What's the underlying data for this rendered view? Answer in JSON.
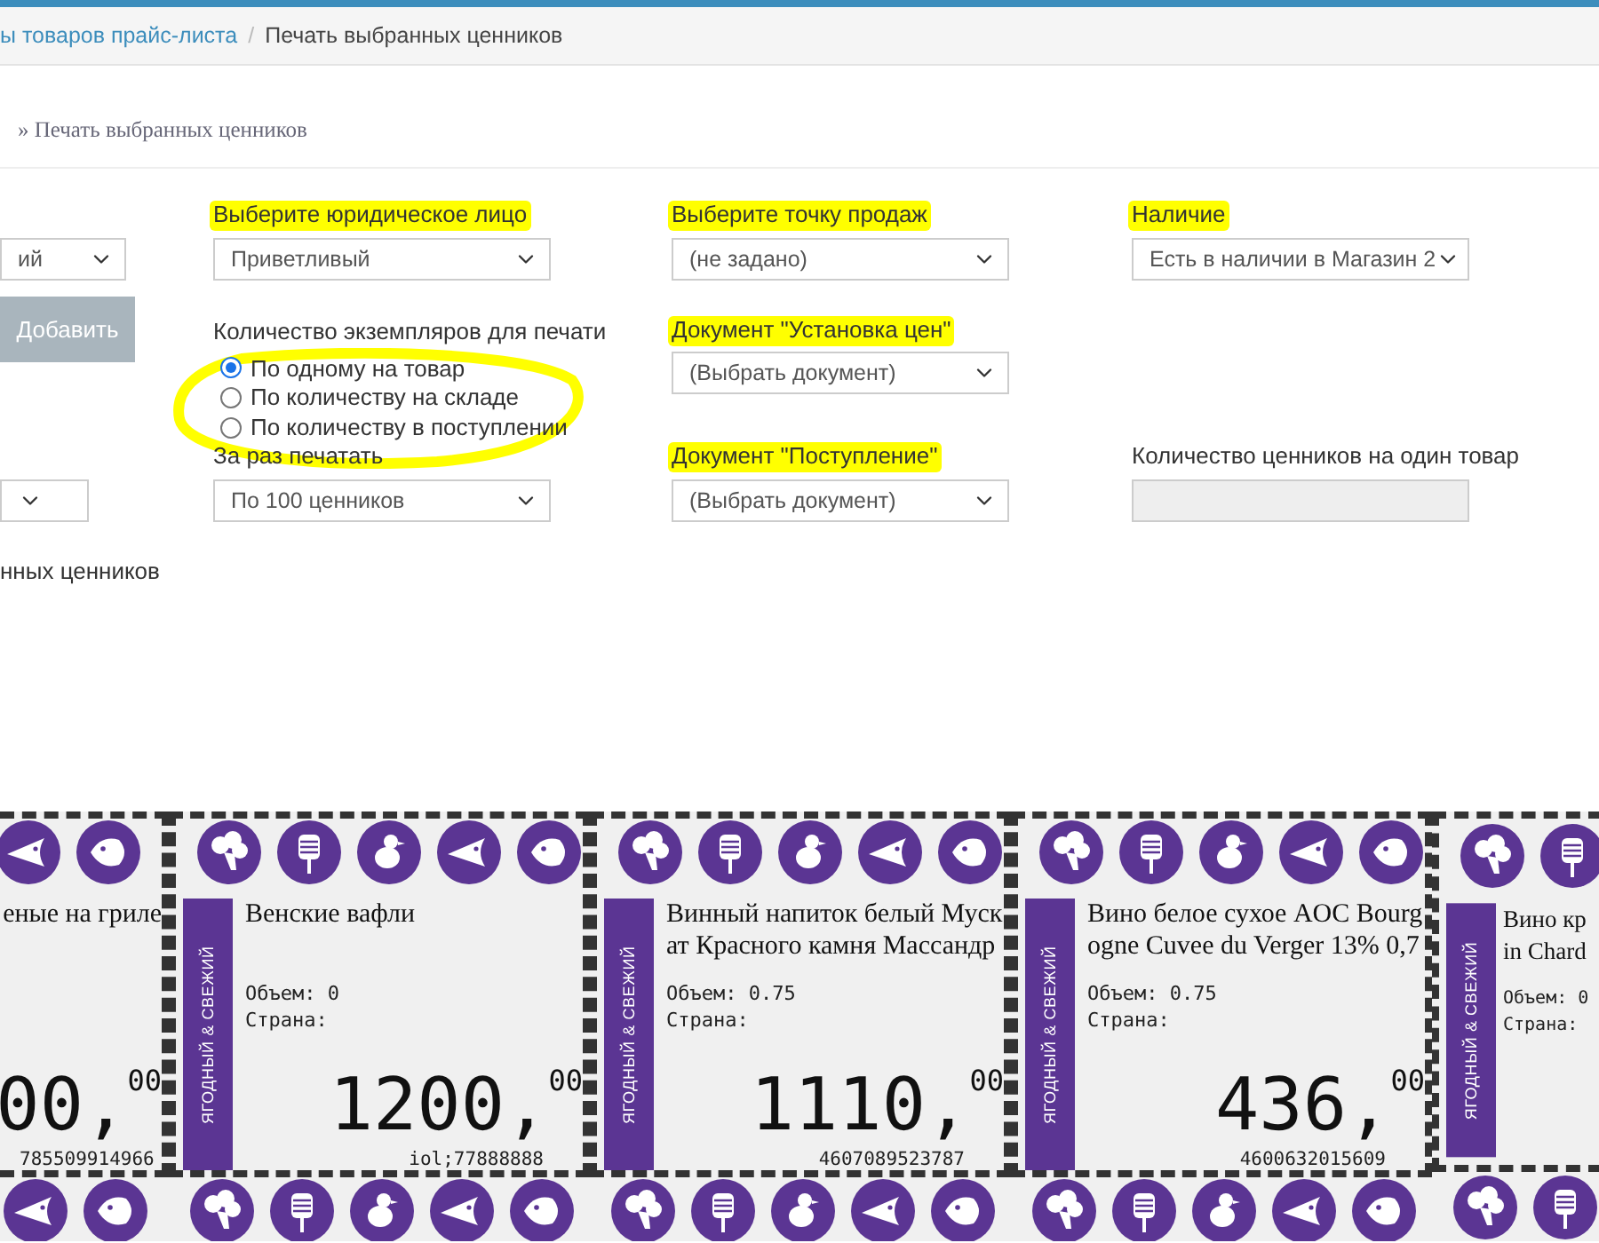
{
  "breadcrumb": {
    "link": "ы товаров прайс-листа",
    "separator": "/",
    "current": "Печать выбранных ценников"
  },
  "subtitle": "» Печать выбранных ценников",
  "form": {
    "left_select": {
      "value": "ий"
    },
    "add_button": "Добавить",
    "legal_entity": {
      "label": "Выберите юридическое лицо",
      "highlighted": true,
      "value": "Приветливый"
    },
    "copies": {
      "label": "Количество экземпляров для печати",
      "highlighted": false,
      "circled": true,
      "options": [
        {
          "label": "По одному на товар",
          "selected": true
        },
        {
          "label": "По количеству на складе",
          "selected": false
        },
        {
          "label": "По количеству в поступлении",
          "selected": false
        }
      ]
    },
    "batch": {
      "label": "За раз печатать",
      "highlighted": false,
      "value": "По 100 ценников"
    },
    "sale_point": {
      "label": "Выберите точку продаж",
      "highlighted": true,
      "value": "(не задано)"
    },
    "price_doc": {
      "label": "Документ \"Установка цен\"",
      "highlighted": true,
      "value": "(Выбрать документ)"
    },
    "receipt_doc": {
      "label": "Документ \"Поступление\"",
      "highlighted": true,
      "value": "(Выбрать документ)"
    },
    "availability": {
      "label": "Наличие",
      "highlighted": true,
      "value": "Есть в наличии в Магазин 2"
    },
    "tags_per_item": {
      "label": "Количество ценников на один товар",
      "highlighted": false,
      "disabled": true
    }
  },
  "section_caption": "нных ценников",
  "price_tags": [
    {
      "kind": "cut-left",
      "title_lines": [
        "еные на гриле"
      ],
      "price": "00,",
      "cents": "00",
      "barcode": "785509914966"
    },
    {
      "kind": "full",
      "brand": "ЯГОДНЫЙ & СВЕЖИЙ",
      "title_lines": [
        "Венские вафли"
      ],
      "volume": "Объем: 0",
      "country": "Страна:",
      "price": "1200,",
      "cents": "00",
      "barcode": "iol;77888888"
    },
    {
      "kind": "full",
      "brand": "ЯГОДНЫЙ & СВЕЖИЙ",
      "title_lines": [
        "Винный напиток белый Муск",
        "ат Красного камня Массандр"
      ],
      "volume": "Объем: 0.75",
      "country": "Страна:",
      "price": "1110,",
      "cents": "00",
      "barcode": "4607089523787"
    },
    {
      "kind": "full",
      "brand": "ЯГОДНЫЙ & СВЕЖИЙ",
      "title_lines": [
        "Вино белое сухое AOC Bourg",
        "ogne Cuvee du Verger 13% 0,7"
      ],
      "volume": "Объем: 0.75",
      "country": "Страна:",
      "price": "436,",
      "cents": "00",
      "barcode": "4600632015609"
    },
    {
      "kind": "cut-right",
      "brand": "ЯГОДНЫЙ & СВЕЖИЙ",
      "title_lines": [
        "Вино кр",
        "in Chard"
      ],
      "volume": "Объем: 0",
      "country": "Страна:"
    }
  ]
}
